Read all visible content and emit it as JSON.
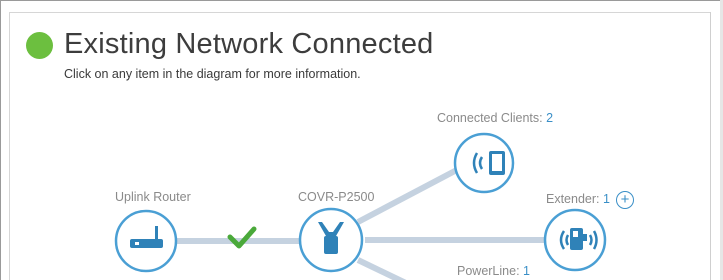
{
  "header": {
    "status_title": "Existing Network Connected",
    "subtitle": "Click on any item in the diagram for more information."
  },
  "diagram": {
    "connected_clients": {
      "label": "Connected Clients: ",
      "count": "2",
      "icon": "tablet-wireless-icon"
    },
    "uplink_router": {
      "label": "Uplink Router",
      "icon": "router-icon"
    },
    "covr": {
      "label": "COVR-P2500",
      "icon": "covr-device-icon"
    },
    "extender": {
      "label": "Extender: ",
      "count": "1",
      "add_label": "+",
      "icon": "extender-icon"
    },
    "powerline": {
      "label": "PowerLine: ",
      "count": "1"
    },
    "link_status": "check-icon"
  },
  "colors": {
    "status_green": "#6cbf3f",
    "node_border": "#4a9fd4",
    "icon_blue": "#2f82b8",
    "link": "#c5d2e0",
    "count_blue": "#3a8fc7",
    "check_green": "#4aa93a"
  }
}
